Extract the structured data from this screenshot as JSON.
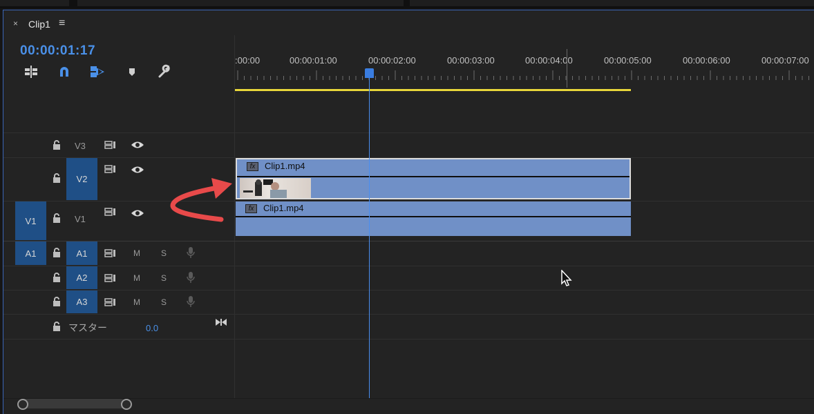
{
  "panel": {
    "close_glyph": "×",
    "title": "Clip1",
    "menu_glyph": "≡"
  },
  "timecode": "00:00:01:17",
  "toolbar": {
    "icons": [
      "insert-sequence-icon",
      "snap-magnet-icon",
      "linked-selection-icon",
      "add-marker-icon",
      "wrench-settings-icon"
    ]
  },
  "ruler": {
    "labels": [
      ":00:00",
      "00:00:01:00",
      "00:00:02:00",
      "00:00:03:00",
      "00:00:04:00",
      "00:00:05:00",
      "00:00:06:00",
      "00:00:07:00"
    ]
  },
  "tracks": {
    "v3": {
      "name": "V3"
    },
    "v2": {
      "name": "V2"
    },
    "v1": {
      "name": "V1",
      "source": "V1"
    },
    "a1": {
      "name": "A1",
      "source": "A1",
      "mute": "M",
      "solo": "S"
    },
    "a2": {
      "name": "A2",
      "mute": "M",
      "solo": "S"
    },
    "a3": {
      "name": "A3",
      "mute": "M",
      "solo": "S"
    },
    "master": {
      "name": "マスター",
      "volume": "0.0"
    }
  },
  "clips": {
    "v2": {
      "name": "Clip1.mp4",
      "fx": "fx"
    },
    "v1": {
      "name": "Clip1.mp4",
      "fx": "fx"
    }
  },
  "colors": {
    "accent_blue": "#4a90e8",
    "clip_blue": "#7090c7",
    "target_blue": "#1f4f86",
    "work_area_yellow": "#e8d63a",
    "arrow_red": "#e84a4a"
  }
}
